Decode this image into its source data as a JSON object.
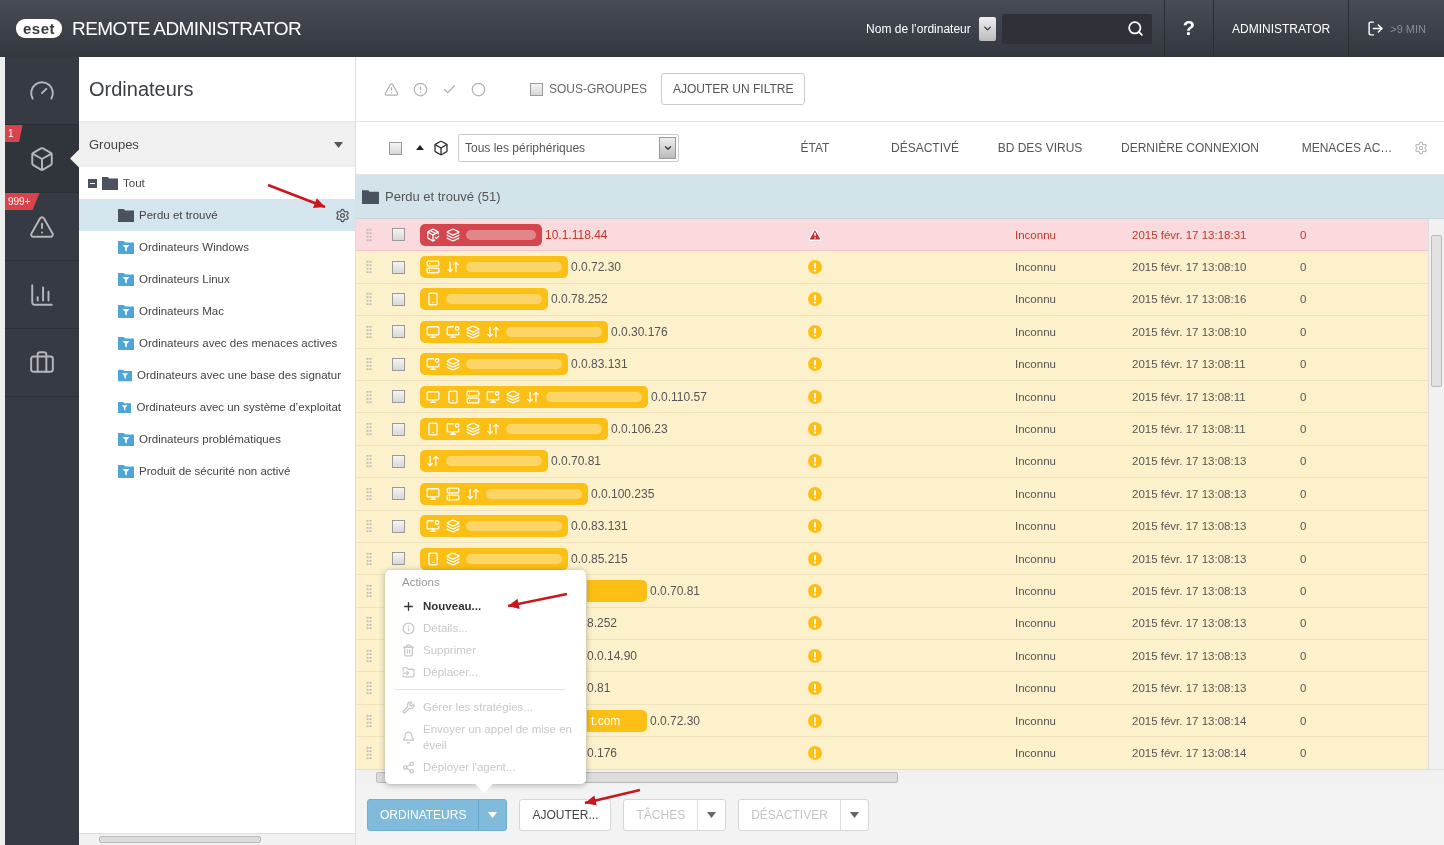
{
  "header": {
    "logo": "eset",
    "title": "REMOTE ADMINISTRATOR",
    "search_scope": "Nom de l’ordinateur",
    "help": "?",
    "user": "ADMINISTRATOR",
    "session": ">9 MIN"
  },
  "nav": [
    {
      "kind": "dashboard",
      "selected": false
    },
    {
      "kind": "computers",
      "selected": true,
      "badge": "1"
    },
    {
      "kind": "threats",
      "selected": false,
      "badge": "999+"
    },
    {
      "kind": "reports",
      "selected": false
    },
    {
      "kind": "admin",
      "selected": false
    }
  ],
  "groups_panel": {
    "title": "Ordinateurs",
    "header": "Groupes",
    "tree": [
      {
        "label": "Tout",
        "kind": "static",
        "expanded": true,
        "selected": false,
        "children": [
          {
            "label": "Perdu et trouvé",
            "kind": "static",
            "selected": true
          },
          {
            "label": "Ordinateurs Windows",
            "kind": "dynamic",
            "selected": false
          },
          {
            "label": "Ordinateurs Linux",
            "kind": "dynamic",
            "selected": false
          },
          {
            "label": "Ordinateurs Mac",
            "kind": "dynamic",
            "selected": false
          },
          {
            "label": "Ordinateurs avec des menaces actives",
            "kind": "dynamic",
            "selected": false
          },
          {
            "label": "Ordinateurs avec une base des signatur",
            "kind": "dynamic",
            "selected": false
          },
          {
            "label": "Ordinateurs avec un système d’exploitat",
            "kind": "dynamic",
            "selected": false
          },
          {
            "label": "Ordinateurs problématiques",
            "kind": "dynamic",
            "selected": false
          },
          {
            "label": "Produit de sécurité non activé",
            "kind": "dynamic",
            "selected": false
          }
        ]
      }
    ]
  },
  "toolbar": {
    "subgroups": {
      "label": "SOUS-GROUPES",
      "checked": false
    },
    "add_filter": "AJOUTER UN FILTRE"
  },
  "table": {
    "select_all": false,
    "device_filter": "Tous les périphériques",
    "columns": [
      "ÉTAT",
      "DÉSACTIVÉ",
      "BD DES VIRUS",
      "DERNIÈRE CONNEXION",
      "MENACES AC…"
    ],
    "group_row": "Perdu et trouvé (51)",
    "rows": [
      {
        "kind": "error",
        "checked": false,
        "icons": [
          {
            "kind": "product"
          },
          {
            "kind": "vm"
          }
        ],
        "ip": "10.1.118.44",
        "virus_db": "Inconnu",
        "last_connected": "2015 févr. 17 13:18:31",
        "threats": "0"
      },
      {
        "kind": "warning",
        "checked": false,
        "icons": [
          {
            "kind": "server"
          },
          {
            "kind": "network"
          }
        ],
        "ip": "0.0.72.30",
        "virus_db": "Inconnu",
        "last_connected": "2015 févr. 17 13:08:10",
        "threats": "0"
      },
      {
        "kind": "warning",
        "checked": false,
        "icons": [
          {
            "kind": "mobile"
          }
        ],
        "ip": "0.0.78.252",
        "virus_db": "Inconnu",
        "last_connected": "2015 févr. 17 13:08:16",
        "threats": "0"
      },
      {
        "kind": "warning",
        "checked": false,
        "icons": [
          {
            "kind": "desktop"
          },
          {
            "kind": "vm-desktop"
          },
          {
            "kind": "vm"
          },
          {
            "kind": "network"
          }
        ],
        "ip": "0.0.30.176",
        "virus_db": "Inconnu",
        "last_connected": "2015 févr. 17 13:08:10",
        "threats": "0"
      },
      {
        "kind": "warning",
        "checked": false,
        "icons": [
          {
            "kind": "vm-desktop"
          },
          {
            "kind": "vm"
          }
        ],
        "ip": "0.0.83.131",
        "virus_db": "Inconnu",
        "last_connected": "2015 févr. 17 13:08:11",
        "threats": "0"
      },
      {
        "kind": "warning",
        "checked": false,
        "icons": [
          {
            "kind": "desktop"
          },
          {
            "kind": "mobile"
          },
          {
            "kind": "server"
          },
          {
            "kind": "vm-desktop"
          },
          {
            "kind": "vm"
          },
          {
            "kind": "network"
          }
        ],
        "ip": "0.0.110.57",
        "virus_db": "Inconnu",
        "last_connected": "2015 févr. 17 13:08:11",
        "threats": "0"
      },
      {
        "kind": "warning",
        "checked": false,
        "icons": [
          {
            "kind": "mobile"
          },
          {
            "kind": "vm-desktop"
          },
          {
            "kind": "vm"
          },
          {
            "kind": "network"
          }
        ],
        "ip": "0.0.106.23",
        "virus_db": "Inconnu",
        "last_connected": "2015 févr. 17 13:08:11",
        "threats": "0"
      },
      {
        "kind": "warning",
        "checked": false,
        "icons": [
          {
            "kind": "network"
          }
        ],
        "ip": "0.0.70.81",
        "virus_db": "Inconnu",
        "last_connected": "2015 févr. 17 13:08:13",
        "threats": "0"
      },
      {
        "kind": "warning",
        "checked": false,
        "icons": [
          {
            "kind": "desktop"
          },
          {
            "kind": "server"
          },
          {
            "kind": "network"
          }
        ],
        "ip": "0.0.100.235",
        "virus_db": "Inconnu",
        "last_connected": "2015 févr. 17 13:08:13",
        "threats": "0"
      },
      {
        "kind": "warning",
        "checked": false,
        "icons": [
          {
            "kind": "vm-desktop"
          },
          {
            "kind": "vm"
          }
        ],
        "ip": "0.0.83.131",
        "virus_db": "Inconnu",
        "last_connected": "2015 févr. 17 13:08:13",
        "threats": "0"
      },
      {
        "kind": "warning",
        "checked": false,
        "icons": [
          {
            "kind": "mobile"
          },
          {
            "kind": "vm"
          }
        ],
        "ip": "0.0.85.215",
        "virus_db": "Inconnu",
        "last_connected": "2015 févr. 17 13:08:13",
        "threats": "0"
      },
      {
        "kind": "warning",
        "tail": true,
        "ip": "0.0.70.81",
        "virus_db": "Inconnu",
        "last_connected": "2015 févr. 17 13:08:13",
        "threats": "0"
      },
      {
        "kind": "warning",
        "tail": false,
        "ip": "8.252",
        "virus_db": "Inconnu",
        "last_connected": "2015 févr. 17 13:08:13",
        "threats": "0"
      },
      {
        "kind": "warning",
        "tail": false,
        "ip": "0.0.14.90",
        "virus_db": "Inconnu",
        "last_connected": "2015 févr. 17 13:08:13",
        "threats": "0"
      },
      {
        "kind": "warning",
        "tail": false,
        "ip": "0.81",
        "virus_db": "Inconnu",
        "last_connected": "2015 févr. 17 13:08:13",
        "threats": "0"
      },
      {
        "kind": "warning",
        "tail": true,
        "tail_text": "t.com",
        "ip": "0.0.72.30",
        "virus_db": "Inconnu",
        "last_connected": "2015 févr. 17 13:08:14",
        "threats": "0"
      },
      {
        "kind": "warning",
        "tail": false,
        "ip": "0.176",
        "virus_db": "Inconnu",
        "last_connected": "2015 févr. 17 13:08:14",
        "threats": "0"
      }
    ]
  },
  "context_menu": {
    "title": "Actions",
    "sections": [
      [
        {
          "kind": "new",
          "label": "Nouveau...",
          "disabled": false
        },
        {
          "kind": "details",
          "label": "Détails...",
          "disabled": true
        },
        {
          "kind": "delete",
          "label": "Supprimer",
          "disabled": true
        },
        {
          "kind": "move",
          "label": "Déplacer...",
          "disabled": true
        }
      ],
      [
        {
          "kind": "policies",
          "label": "Gérer les stratégies...",
          "disabled": true
        },
        {
          "kind": "wakeup",
          "label": "Envoyer un appel de mise en éveil",
          "disabled": true
        },
        {
          "kind": "deploy",
          "label": "Déployer l'agent...",
          "disabled": true
        }
      ]
    ]
  },
  "bottom_buttons": [
    {
      "label": "ORDINATEURS",
      "kind": "primary",
      "has_menu": true,
      "disabled": false
    },
    {
      "label": "AJOUTER...",
      "kind": "default",
      "has_menu": false,
      "disabled": false
    },
    {
      "label": "TÂCHES",
      "kind": "default",
      "has_menu": true,
      "disabled": true
    },
    {
      "label": "DÉSACTIVER",
      "kind": "default",
      "has_menu": true,
      "disabled": true
    }
  ]
}
